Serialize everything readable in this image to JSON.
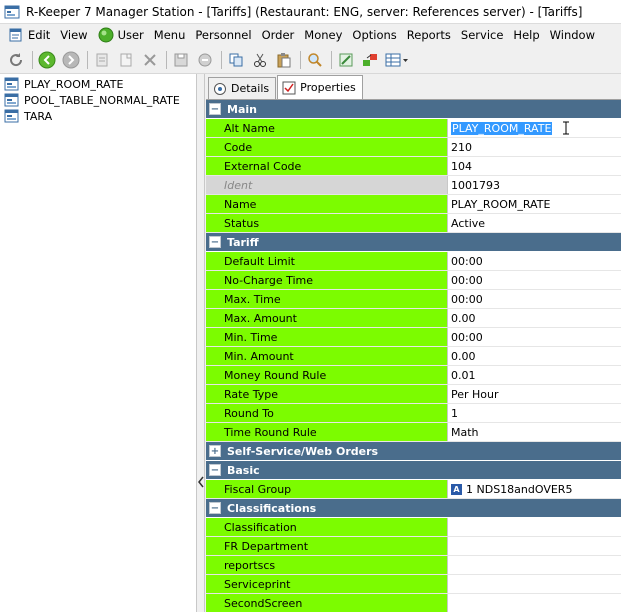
{
  "window": {
    "title": "R-Keeper 7 Manager Station - [Tariffs] (Restaurant: ENG, server: References server) - [Tariffs]"
  },
  "menu": [
    {
      "label": "Edit",
      "icon": "app-doc-icon"
    },
    {
      "label": "View"
    },
    {
      "label": "User",
      "icon": "green-circle-icon"
    },
    {
      "label": "Menu"
    },
    {
      "label": "Personnel"
    },
    {
      "label": "Order"
    },
    {
      "label": "Money"
    },
    {
      "label": "Options"
    },
    {
      "label": "Reports"
    },
    {
      "label": "Service"
    },
    {
      "label": "Help"
    },
    {
      "label": "Window"
    }
  ],
  "toolbar": {
    "buttons": [
      "refresh-icon",
      "back-icon",
      "forward-icon",
      "print-icon",
      "new-doc-icon",
      "delete-icon",
      "save-icon",
      "cancel-icon",
      "copy-icon",
      "cut-icon",
      "paste-icon",
      "search-icon",
      "tools-icon",
      "export-icon",
      "grid-view-icon"
    ]
  },
  "tree": {
    "items": [
      {
        "label": "PLAY_ROOM_RATE"
      },
      {
        "label": "POOL_TABLE_NORMAL_RATE"
      },
      {
        "label": "TARA"
      }
    ]
  },
  "tabs": [
    {
      "label": "Details",
      "active": false
    },
    {
      "label": "Properties",
      "active": true
    }
  ],
  "sections": {
    "main": {
      "title": "Main",
      "toggle": "−"
    },
    "tariff": {
      "title": "Tariff",
      "toggle": "−"
    },
    "selfservice": {
      "title": "Self-Service/Web Orders",
      "toggle": "+"
    },
    "basic": {
      "title": "Basic",
      "toggle": "−"
    },
    "classifications": {
      "title": "Classifications",
      "toggle": "−"
    }
  },
  "main": {
    "alt_name": {
      "label": "Alt Name",
      "value": "PLAY_ROOM_RATE"
    },
    "code": {
      "label": "Code",
      "value": "210"
    },
    "external_code": {
      "label": "External Code",
      "value": "104"
    },
    "ident": {
      "label": "Ident",
      "value": "1001793"
    },
    "name": {
      "label": "Name",
      "value": "PLAY_ROOM_RATE"
    },
    "status": {
      "label": "Status",
      "value": "Active"
    }
  },
  "tariff": {
    "default_limit": {
      "label": "Default Limit",
      "value": "00:00"
    },
    "no_charge_time": {
      "label": "No-Charge Time",
      "value": "00:00"
    },
    "max_time": {
      "label": "Max. Time",
      "value": "00:00"
    },
    "max_amount": {
      "label": "Max. Amount",
      "value": "0.00"
    },
    "min_time": {
      "label": "Min. Time",
      "value": "00:00"
    },
    "min_amount": {
      "label": "Min. Amount",
      "value": "0.00"
    },
    "money_round_rule": {
      "label": "Money Round Rule",
      "value": "0.01"
    },
    "rate_type": {
      "label": "Rate Type",
      "value": "Per Hour"
    },
    "round_to": {
      "label": "Round To",
      "value": "1"
    },
    "time_round_rule": {
      "label": "Time Round Rule",
      "value": "Math"
    }
  },
  "basic": {
    "fiscal_group": {
      "label": "Fiscal Group",
      "value": "1 NDS18andOVER5",
      "badge": "A"
    }
  },
  "classifications": {
    "classification": {
      "label": "Classification",
      "value": ""
    },
    "fr_department": {
      "label": "FR Department",
      "value": ""
    },
    "reportscs": {
      "label": "reportscs",
      "value": ""
    },
    "serviceprint": {
      "label": "Serviceprint",
      "value": ""
    },
    "secondscreen": {
      "label": "SecondScreen",
      "value": ""
    }
  },
  "colors": {
    "section_header": "#4a6d8c",
    "label_bg": "#7cfc00",
    "readonly_bg": "#d6d6d6",
    "selection": "#3399ff"
  }
}
